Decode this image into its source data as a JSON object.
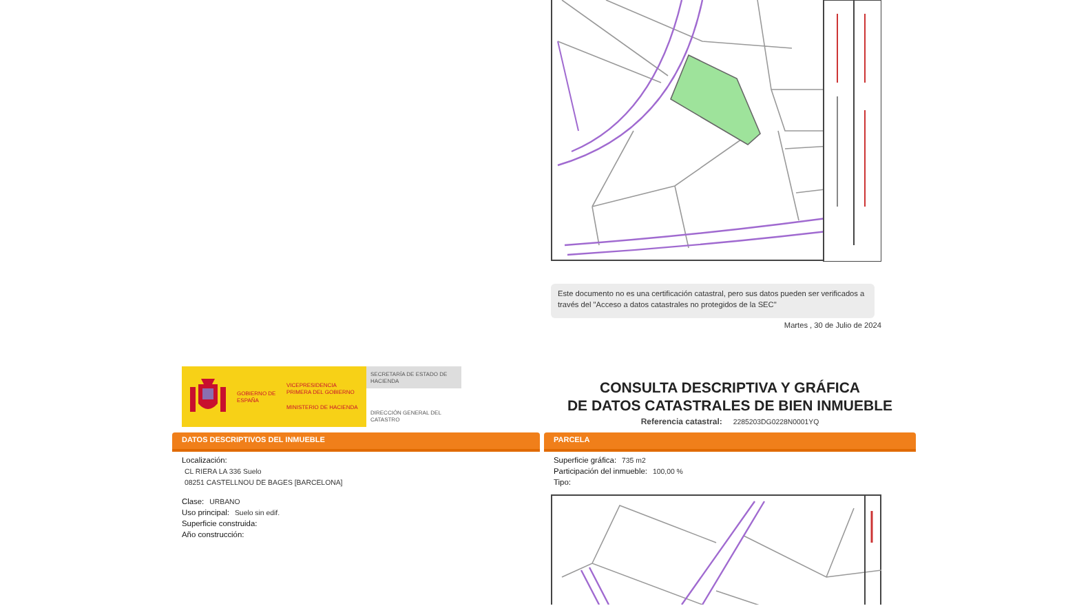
{
  "notice": {
    "text": "Este documento no es una certificación catastral, pero sus datos pueden ser verificados a través del \"Acceso a datos catastrales no protegidos de la SEC\"",
    "date": "Martes , 30 de Julio de 2024"
  },
  "header": {
    "gobierno": "GOBIERNO DE ESPAÑA",
    "vicepresidencia": "VICEPRESIDENCIA PRIMERA DEL GOBIERNO",
    "ministerio": "MINISTERIO DE HACIENDA",
    "secretaria": "SECRETARÍA DE ESTADO DE HACIENDA",
    "direccion": "DIRECCIÓN GENERAL DEL CATASTRO"
  },
  "title_lines": [
    "CONSULTA DESCRIPTIVA Y GRÁFICA",
    "DE DATOS CATASTRALES DE BIEN INMUEBLE"
  ],
  "reference": {
    "label": "Referencia catastral:",
    "value": "2285203DG0228N0001YQ"
  },
  "inmueble": {
    "heading": "DATOS DESCRIPTIVOS DEL INMUEBLE",
    "location_label": "Localización:",
    "address_lines": [
      "CL RIERA LA 336 Suelo",
      "08251 CASTELLNOU DE BAGES [BARCELONA]"
    ],
    "fields": [
      {
        "label": "Clase:",
        "value": "URBANO"
      },
      {
        "label": "Uso principal:",
        "value": "Suelo sin edif."
      },
      {
        "label": "Superficie construida:"
      },
      {
        "label": "Año construcción:"
      }
    ]
  },
  "parcela": {
    "heading": "PARCELA",
    "fields": [
      {
        "label": "Superficie gráfica:",
        "value": "735 m2"
      },
      {
        "label": "Participación del inmueble:",
        "value": "100,00 %"
      },
      {
        "label": "Tipo:"
      }
    ]
  }
}
